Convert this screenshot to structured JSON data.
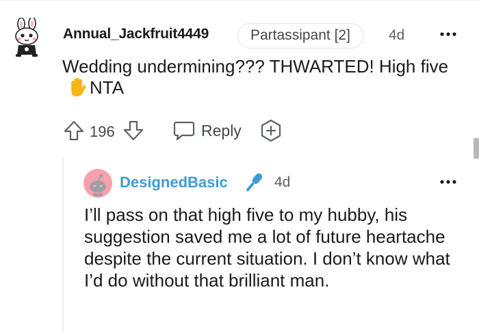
{
  "comment": {
    "username": "Annual_Jackfruit4449",
    "flair": "Partassipant [2]",
    "time": "4d",
    "text_part1": "Wedding undermining??? THWARTED! High five",
    "emoji_icon": "raised-hand-emoji",
    "text_part2": "NTA",
    "votes": "196",
    "reply_label": "Reply",
    "icons": {
      "avatar": "snoo-bunny-avatar",
      "more": "more-options-icon",
      "upvote": "upvote-arrow-icon",
      "downvote": "downvote-arrow-icon",
      "reply": "speech-bubble-icon",
      "award": "add-award-icon"
    }
  },
  "reply": {
    "username": "DesignedBasic",
    "time": "4d",
    "text": "I’ll pass on that high five to my hubby, his suggestion saved me a lot of future heartache despite the current situation. I don’t know what I’d do without that brilliant man.",
    "icons": {
      "avatar": "snoo-avatar",
      "badge": "microphone-icon",
      "more": "more-options-icon"
    }
  },
  "colors": {
    "username_reply": "#3e9bd6",
    "meta_text": "#5c6066",
    "divider": "#edeff1",
    "emoji": "#f7b516"
  }
}
